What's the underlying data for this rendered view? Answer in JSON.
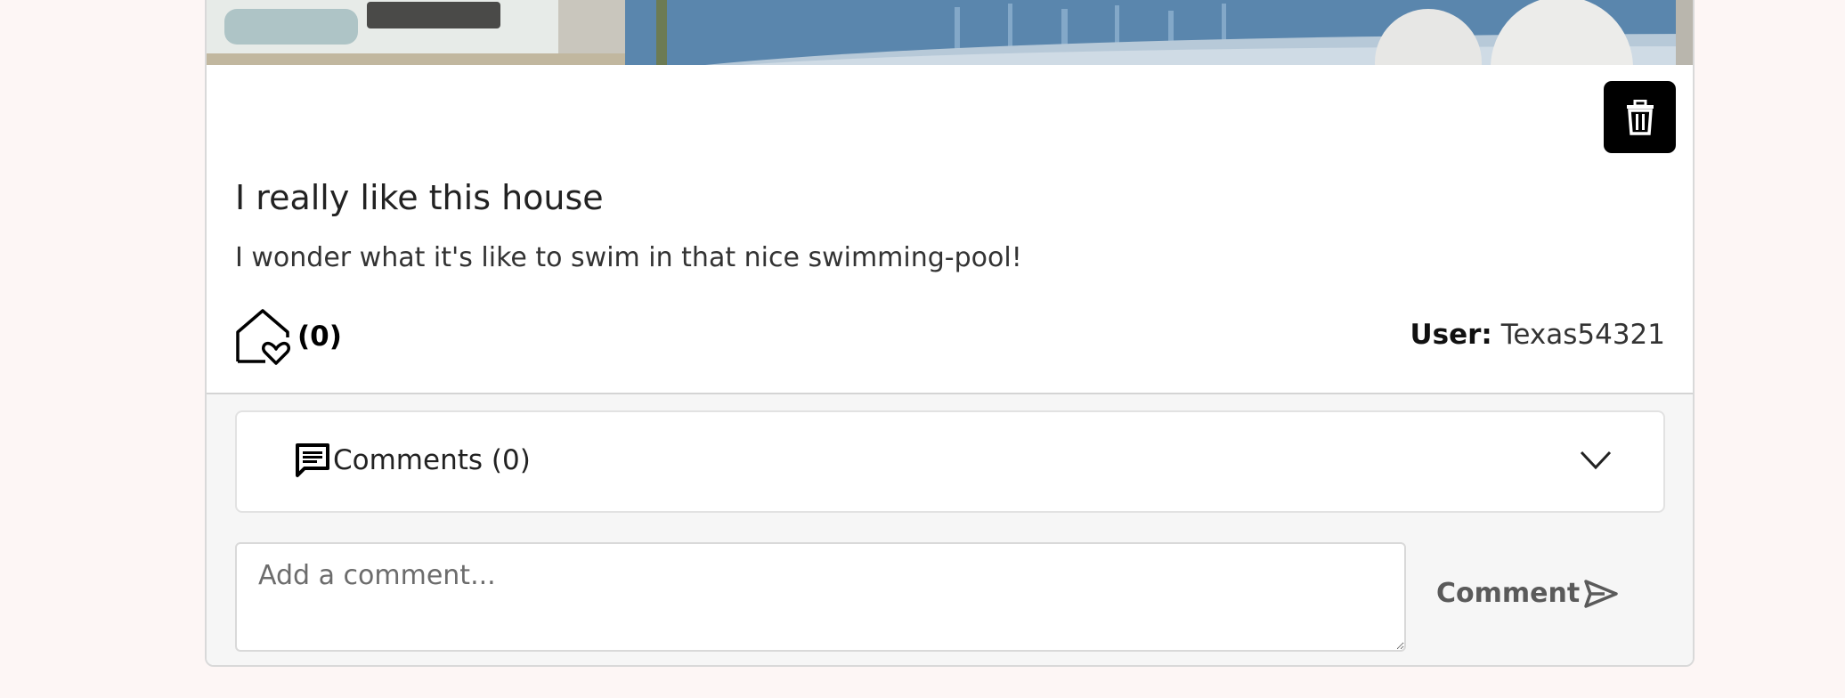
{
  "post": {
    "title": "I really like this house",
    "body": "I wonder what it's like to swim in that nice swimming-pool!",
    "likes": "(0)",
    "user_label": "User:",
    "username": "Texas54321"
  },
  "comments": {
    "toggle_label": "Comments (0)",
    "input_placeholder": "Add a comment...",
    "submit_label": "Comment"
  },
  "icons": {
    "delete": "trash-icon",
    "like": "house-heart-icon",
    "comments": "chat-icon",
    "toggle": "chevron-down-icon",
    "submit": "send-icon"
  },
  "colors": {
    "page_background": "#fdf6f5",
    "card_background": "#ffffff",
    "footer_background": "#f6f6f6",
    "delete_button": "#000000",
    "comment_button_text": "#5a5a5a"
  }
}
